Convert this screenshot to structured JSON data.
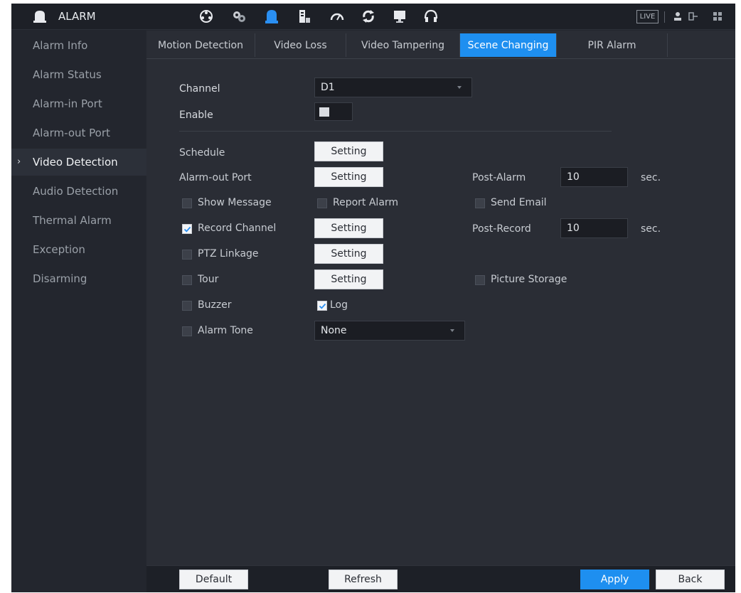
{
  "header": {
    "title": "ALARM",
    "icons": [
      "camera-network-icon",
      "gear-cluster-icon",
      "alarm-bell-icon",
      "storage-icon",
      "speedometer-icon",
      "refresh-icon",
      "display-icon",
      "headset-icon"
    ],
    "live_label": "LIVE",
    "right_icons": [
      "user-icon",
      "logout-icon",
      "grid-icon"
    ],
    "accent": "#1e8ff0"
  },
  "sidebar": {
    "items": [
      {
        "label": "Alarm Info"
      },
      {
        "label": "Alarm Status"
      },
      {
        "label": "Alarm-in Port"
      },
      {
        "label": "Alarm-out Port"
      },
      {
        "label": "Video Detection",
        "active": true
      },
      {
        "label": "Audio Detection"
      },
      {
        "label": "Thermal Alarm"
      },
      {
        "label": "Exception"
      },
      {
        "label": "Disarming"
      }
    ],
    "active_marker": "›"
  },
  "tabs": [
    {
      "label": "Motion Detection"
    },
    {
      "label": "Video Loss"
    },
    {
      "label": "Video Tampering"
    },
    {
      "label": "Scene Changing",
      "active": true
    },
    {
      "label": "PIR Alarm"
    }
  ],
  "form": {
    "channel_label": "Channel",
    "channel_value": "D1",
    "enable_label": "Enable",
    "enable_on": true,
    "schedule_label": "Schedule",
    "setting_label": "Setting",
    "alarm_out_label": "Alarm-out Port",
    "post_alarm_label": "Post-Alarm",
    "post_alarm_value": "10",
    "sec_label": "sec.",
    "show_message_label": "Show Message",
    "show_message_checked": false,
    "report_alarm_label": "Report Alarm",
    "report_alarm_checked": false,
    "send_email_label": "Send Email",
    "send_email_checked": false,
    "record_channel_label": "Record Channel",
    "record_channel_checked": true,
    "post_record_label": "Post-Record",
    "post_record_value": "10",
    "ptz_label": "PTZ Linkage",
    "ptz_checked": false,
    "tour_label": "Tour",
    "tour_checked": false,
    "picture_storage_label": "Picture Storage",
    "picture_storage_checked": false,
    "buzzer_label": "Buzzer",
    "buzzer_checked": false,
    "log_label": "Log",
    "log_checked": true,
    "alarm_tone_label": "Alarm Tone",
    "alarm_tone_checked": false,
    "alarm_tone_value": "None"
  },
  "footer": {
    "default_label": "Default",
    "refresh_label": "Refresh",
    "apply_label": "Apply",
    "back_label": "Back"
  }
}
